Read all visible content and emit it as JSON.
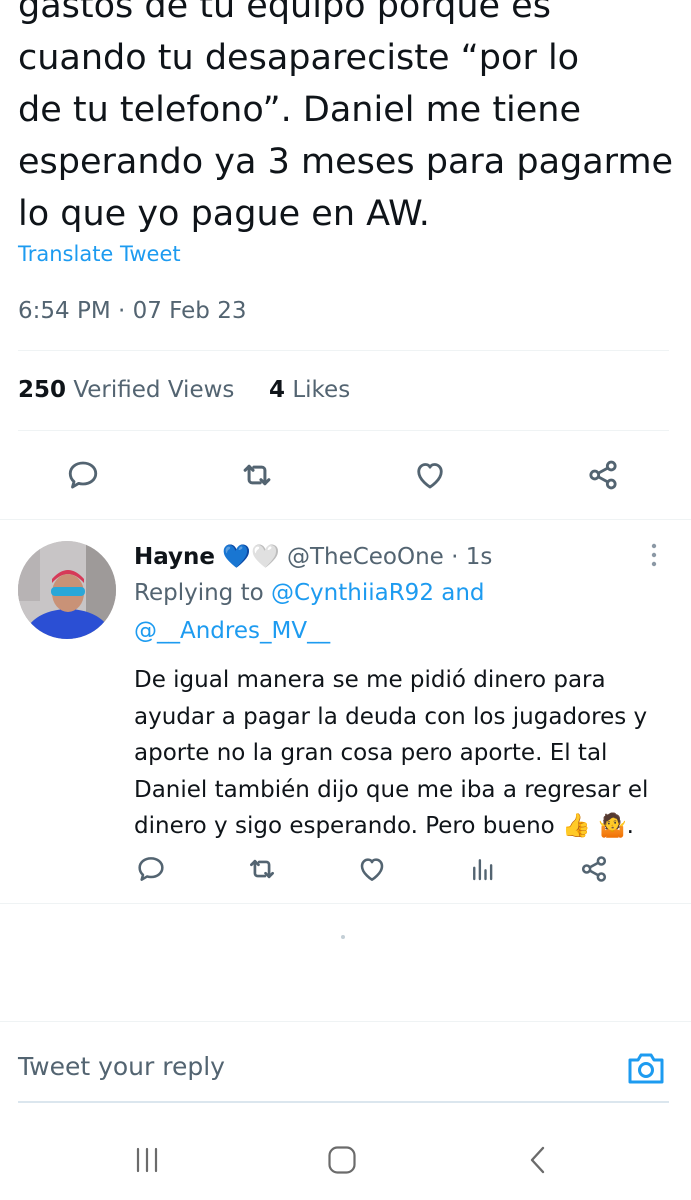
{
  "tweet": {
    "lines": [
      "gastos de tu equipo porque es",
      "cuando tu desapareciste “por lo",
      "de tu telefono”. Daniel me tiene",
      "esperando ya 3 meses para pagarme",
      "lo que yo pague en AW."
    ],
    "translate_label": "Translate Tweet",
    "timestamp": "6:54 PM · 07 Feb 23",
    "views_count": "250",
    "views_label": "Verified Views",
    "likes_count": "4",
    "likes_label": "Likes"
  },
  "icons": {
    "reply": "reply-bubble-icon",
    "retweet": "retweet-icon",
    "like": "heart-icon",
    "share": "share-icon",
    "views": "views-chart-icon",
    "more": "more-vertical-icon",
    "camera": "camera-icon"
  },
  "reply": {
    "name": "Hayne",
    "badges": "💙🤍",
    "handle": "@TheCeoOne",
    "time": "· 1s",
    "replying_prefix": "Replying to",
    "mention1": "@CynthiiaR92",
    "and_word": "and",
    "mention2": "@__Andres_MV__",
    "lines": [
      "De igual manera se me pidió dinero para",
      "ayudar a pagar la deuda con los jugadores y",
      "aporte no la gran cosa pero aporte. El tal",
      "Daniel también dijo que me iba a regresar el",
      "dinero y sigo esperando. Pero bueno 👍 🤷."
    ]
  },
  "composer": {
    "placeholder": "Tweet your reply"
  },
  "colors": {
    "accent": "#1d9bf0",
    "text": "#0f1419",
    "secondary": "#536471",
    "divider": "#eff3f4"
  }
}
